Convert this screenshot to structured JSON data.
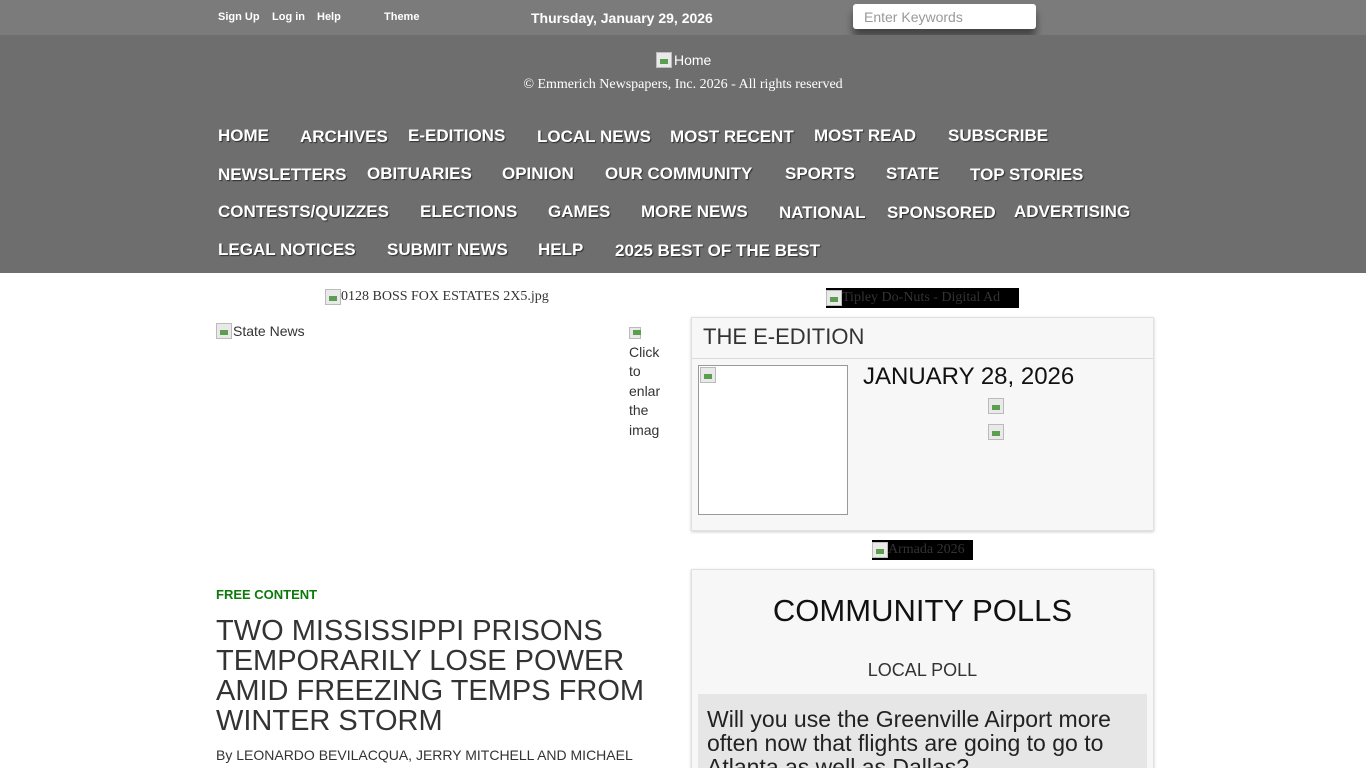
{
  "topbar": {
    "signup": "Sign Up",
    "login": "Log in",
    "help": "Help",
    "theme": "Theme",
    "date": "Thursday, January 29, 2026",
    "search_placeholder": "Enter Keywords"
  },
  "masthead": {
    "logo_alt": "Home",
    "copyright": "© Emmerich Newspapers, Inc. 2026 - All rights reserved"
  },
  "nav": [
    "HOME",
    "ARCHIVES",
    "E-EDITIONS",
    "LOCAL NEWS",
    "MOST RECENT",
    "MOST READ",
    "SUBSCRIBE",
    "NEWSLETTERS",
    "OBITUARIES",
    "OPINION",
    "OUR COMMUNITY",
    "SPORTS",
    "STATE",
    "TOP STORIES",
    "CONTESTS/QUIZZES",
    "ELECTIONS",
    "GAMES",
    "MORE NEWS",
    "NATIONAL",
    "SPONSORED",
    "ADVERTISING",
    "LEGAL NOTICES",
    "SUBMIT NEWS",
    "HELP",
    "2025 BEST OF THE BEST"
  ],
  "ads": {
    "boss": "0128 BOSS FOX ESTATES 2X5.jpg",
    "tipley": "Tipley Do-Nuts - Digital Ad",
    "armada": "Armada 2026"
  },
  "article": {
    "image_alt": "State News",
    "enlarge_text": "Click to enlarge the image",
    "label": "FREE CONTENT",
    "headline": "Two Mississippi prisons temporarily lose power amid freezing temps from winter storm",
    "byline_prefix": "By",
    "authors": "LEONARDO BEVILACQUA, JERRY MITCHELL AND MICHAEL"
  },
  "eedition": {
    "title": "THE E-EDITION",
    "date": "JANUARY 28, 2026"
  },
  "polls": {
    "title": "COMMUNITY POLLS",
    "subtitle": "LOCAL POLL",
    "question": "Will you use the Greenville Airport more often now that flights are going to go to Atlanta as well as Dallas?"
  },
  "colors": {
    "topbar_bg": "#7b7b7b",
    "masthead_bg": "#6e6e6e",
    "free_content": "#0a7a0a",
    "panel_bg": "#f7f7f7"
  }
}
